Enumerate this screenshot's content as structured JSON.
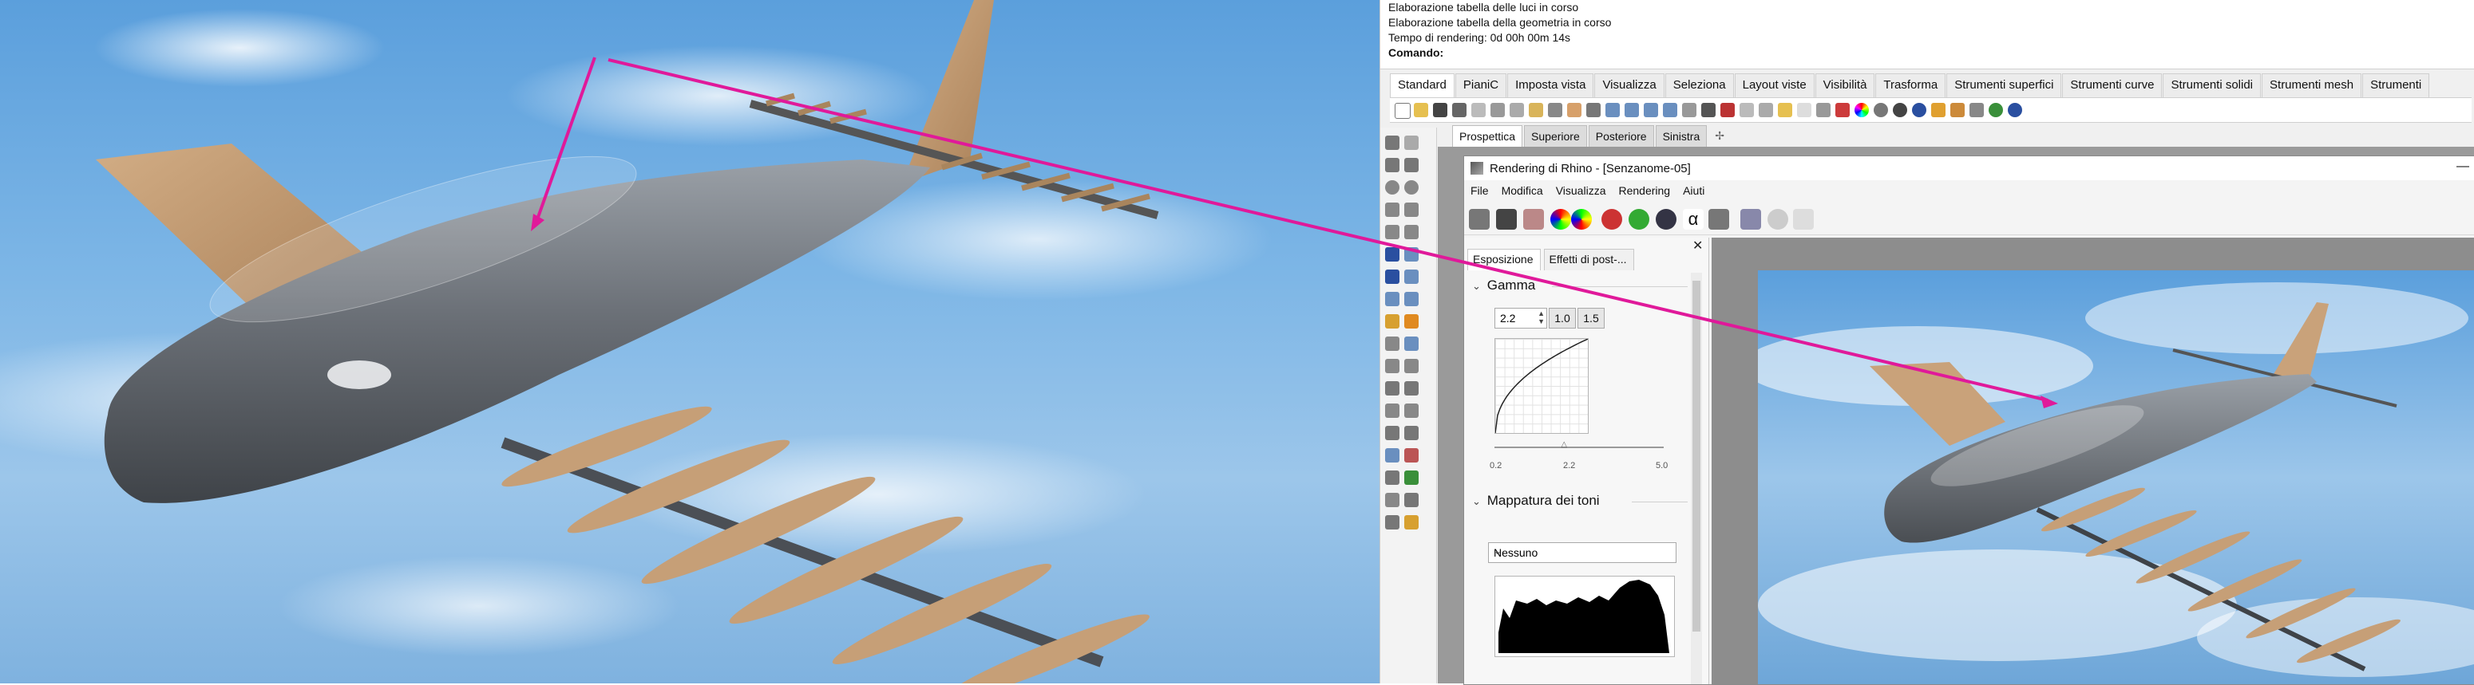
{
  "command_history": {
    "lines": [
      "Elaborazione tabella delle luci in corso",
      "Elaborazione tabella della geometria in corso",
      "Tempo di rendering: 0d 00h 00m 14s"
    ],
    "prompt": "Comando:"
  },
  "toolbar_tabs": [
    "Standard",
    "PianiC",
    "Imposta vista",
    "Visualizza",
    "Seleziona",
    "Layout viste",
    "Visibilità",
    "Trasforma",
    "Strumenti superfici",
    "Strumenti curve",
    "Strumenti solidi",
    "Strumenti mesh",
    "Strumenti"
  ],
  "viewport_tabs": [
    "Prospettica",
    "Superiore",
    "Posteriore",
    "Sinistra"
  ],
  "viewport_add": "✢",
  "render_window": {
    "title": "Rendering di Rhino - [Senzanome-05]",
    "minimize": "—",
    "menu": [
      "File",
      "Modifica",
      "Visualizza",
      "Rendering",
      "Aiuti"
    ],
    "panel": {
      "close": "✕",
      "tabs": [
        "Esposizione",
        "Effetti di post-..."
      ],
      "gamma": {
        "title": "Gamma",
        "value": "2.2",
        "presets": [
          "1.0",
          "1.5"
        ],
        "slider_labels": [
          "0.2",
          "2.2",
          "5.0"
        ],
        "slider_value": 2.2
      },
      "tone_mapping": {
        "title": "Mappatura dei toni",
        "selected": "Nessuno"
      }
    }
  },
  "colors": {
    "annotation_arrow": "#e0199a",
    "fuselage": "#6f7379",
    "wing": "#c9a27a",
    "sky": "#7db6e6"
  },
  "icons": {
    "collapse": "⌄",
    "dropdown": "⌄",
    "spin_up": "▲",
    "spin_down": "▼",
    "slider_knob": "△"
  }
}
